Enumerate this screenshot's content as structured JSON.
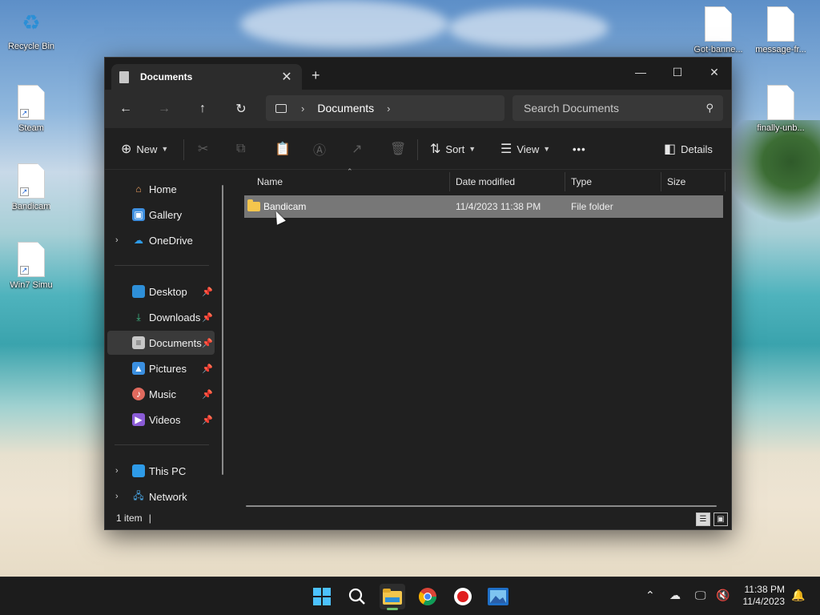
{
  "desktop": {
    "icons_left": [
      {
        "label": "Recycle Bin",
        "icon": "recycle-bin-icon"
      },
      {
        "label": "Steam",
        "icon": "file-shortcut-icon"
      },
      {
        "label": "Bandicam",
        "icon": "file-shortcut-icon"
      },
      {
        "label": "Win7 Simu",
        "icon": "file-shortcut-icon"
      }
    ],
    "icons_right": [
      {
        "label": "Got-banne...",
        "icon": "file-icon"
      },
      {
        "label": "message-fr...",
        "icon": "file-icon"
      },
      {
        "label": "finally-unb...",
        "icon": "file-icon"
      }
    ]
  },
  "window": {
    "tab_title": "Documents",
    "new_tab": "+",
    "controls": {
      "minimize": "—",
      "maximize": "☐",
      "close": "✕"
    }
  },
  "address": {
    "crumbs": [
      "Documents"
    ],
    "search_placeholder": "Search Documents"
  },
  "toolbar": {
    "new_label": "New",
    "sort_label": "Sort",
    "view_label": "View",
    "more_label": "•••",
    "details_label": "Details"
  },
  "sidebar": {
    "items": [
      {
        "label": "Home",
        "icon": "home-icon"
      },
      {
        "label": "Gallery",
        "icon": "gallery-icon"
      },
      {
        "label": "OneDrive",
        "icon": "onedrive-icon"
      },
      {
        "label": "Desktop",
        "icon": "desktop-icon"
      },
      {
        "label": "Downloads",
        "icon": "downloads-icon"
      },
      {
        "label": "Documents",
        "icon": "documents-icon"
      },
      {
        "label": "Pictures",
        "icon": "pictures-icon"
      },
      {
        "label": "Music",
        "icon": "music-icon"
      },
      {
        "label": "Videos",
        "icon": "videos-icon"
      },
      {
        "label": "This PC",
        "icon": "this-pc-icon"
      },
      {
        "label": "Network",
        "icon": "network-icon"
      }
    ],
    "selected": "Documents"
  },
  "columns": {
    "name": "Name",
    "date": "Date modified",
    "type": "Type",
    "size": "Size"
  },
  "rows": [
    {
      "name": "Bandicam",
      "date": "11/4/2023 11:38 PM",
      "type": "File folder",
      "size": ""
    }
  ],
  "status": {
    "count": "1 item"
  },
  "taskbar": {
    "apps": [
      "start-icon",
      "search-icon",
      "file-explorer-icon",
      "chrome-icon",
      "record-icon",
      "photos-icon"
    ],
    "clock_time": "11:38 PM",
    "clock_date": "11/4/2023"
  },
  "colors": {
    "accent": "#4cc2ff",
    "selection": "#777777",
    "folder": "#f4c64d"
  }
}
